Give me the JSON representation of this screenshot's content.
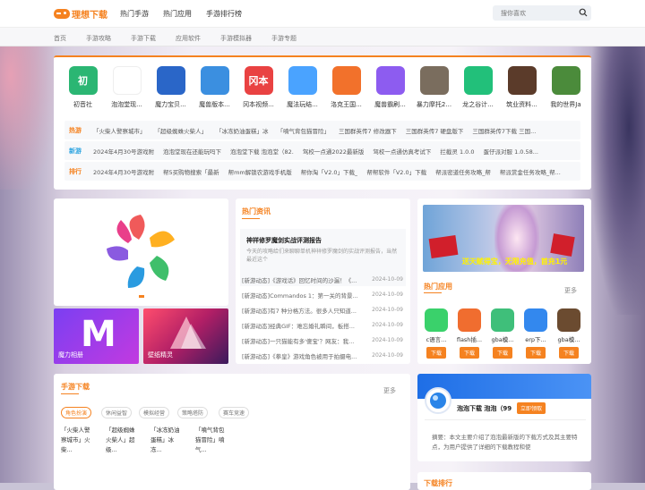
{
  "logo": {
    "text": "理想下载"
  },
  "nav": [
    "热门手游",
    "热门应用",
    "手游排行榜"
  ],
  "search": {
    "placeholder": "搜你喜欢"
  },
  "subnav": [
    "首页",
    "手游攻略",
    "手游下载",
    "应用软件",
    "手游模拟器",
    "手游专题"
  ],
  "apps": [
    {
      "label": "初音社",
      "icon": "chuyin-icon",
      "color": "#2bb673",
      "glyph": "初"
    },
    {
      "label": "泡泡堂现...",
      "icon": "star-swirl-icon",
      "color": "#ffffff",
      "glyph": ""
    },
    {
      "label": "魔力宝贝...",
      "icon": "tv-icon",
      "color": "#2a66c8",
      "glyph": ""
    },
    {
      "label": "魔兽版本...",
      "icon": "e-swirl-icon",
      "color": "#3b8fe0",
      "glyph": ""
    },
    {
      "label": "冈本视频...",
      "icon": "okamoto-icon",
      "color": "#e94242",
      "glyph": "冈本"
    },
    {
      "label": "魔法玩结...",
      "icon": "bird-icon",
      "color": "#4aa3ff",
      "glyph": ""
    },
    {
      "label": "洛克王国...",
      "icon": "roco-icon",
      "color": "#f2712b",
      "glyph": ""
    },
    {
      "label": "魔兽霸刷...",
      "icon": "fan-icon",
      "color": "#8d5cf0",
      "glyph": ""
    },
    {
      "label": "暴力摩托2...",
      "icon": "moto-icon",
      "color": "#7a6d5e",
      "glyph": ""
    },
    {
      "label": "龙之谷计...",
      "icon": "phone-icon",
      "color": "#22c07a",
      "glyph": ""
    },
    {
      "label": "筑业资料...",
      "icon": "medal-icon",
      "color": "#5b3b2a",
      "glyph": ""
    },
    {
      "label": "我的世界Ja",
      "icon": "minecraft-icon",
      "color": "#4b8b3b",
      "glyph": ""
    }
  ],
  "rows": [
    {
      "title": "热游",
      "color": "#f58220",
      "items": [
        "「火柴人警察城市」",
        "「超级蜘蛛火柴人」",
        "「冰冻奶油蛋糕」冰",
        "「噴气背包猫冒险」",
        "三国群英传7 修改器下",
        "三国群英传7 硬盘版下",
        "三国群英传7下载 三国..."
      ]
    },
    {
      "title": "新游",
      "color": "#2aa3e0",
      "items": [
        "2024年4月30号游戏附",
        "泡泡堂现在还能玩吗下",
        "泡泡堂下载 泡泡堂（82.",
        "驾校一点通2022最新版",
        "驾校一点通仿真考试下",
        "拦截灵 1.0.0",
        "蛋仔派对服 1.0.58..."
      ]
    },
    {
      "title": "排行",
      "color": "#f58220",
      "items": [
        "2024年4月30号游戏附",
        "帮5买购物搜索「最新",
        "帮mm解锁农游戏手机版",
        "帮你淘「V2.0」下载_",
        "帮帮软件「V2.0」下载",
        "帮派密道任务攻略_帮",
        "帮派赏金任务攻略_帮..."
      ]
    }
  ],
  "thumbs": [
    {
      "label": "魔力相册"
    },
    {
      "label": "壁纸精灵"
    }
  ],
  "hot_news": {
    "header": "热门资讯",
    "feature_title": "神祥修罗魔剑实战评测报告",
    "feature_desc": "今天的攻略给们来聊聊单机神祥修罗魔剑的实战评测报告，当然最近这个",
    "items": [
      {
        "text": "[新游动态]《游戏话》回忆时间的沙漏！《...",
        "date": "2024-10-09"
      },
      {
        "text": "[新游动态]Commandos 1：第一关的背景...",
        "date": "2024-10-09"
      },
      {
        "text": "[新游动态]有7 种分格方法。很多人只知道...",
        "date": "2024-10-09"
      },
      {
        "text": "[新游动态]经典GIF：难忘婚礼瞬间，板搭...",
        "date": "2024-10-09"
      },
      {
        "text": "[新游动态]一只猫能有多'傻宝'？网友：我...",
        "date": "2024-10-09"
      },
      {
        "text": "[新游动态]《拳皇》游戏角色被用于拍摄电...",
        "date": "2024-10-09"
      }
    ]
  },
  "banner": {
    "text": "送天赋得宝，无限充值，首充1元"
  },
  "hot_apps": {
    "header": "热门应用",
    "more": "更多",
    "items": [
      {
        "label": "c语言...",
        "icon": "chat-icon",
        "color": "#3ad16b"
      },
      {
        "label": "flash插...",
        "icon": "fox-icon",
        "color": "#f06d2f"
      },
      {
        "label": "gba模...",
        "icon": "e-icon",
        "color": "#3fbf7a"
      },
      {
        "label": "erp下...",
        "icon": "dots-icon",
        "color": "#3388ee"
      },
      {
        "label": "gba模...",
        "icon": "badge-icon",
        "color": "#6b4b30"
      }
    ],
    "button": "下载"
  },
  "mobile_dl": {
    "header": "手游下载",
    "more": "更多",
    "tabs": [
      "角色扮演",
      "休闲益智",
      "模拟经营",
      "策略塔防",
      "赛车竞速"
    ],
    "items": [
      "「火柴人警察城市」火柴...",
      "「超级蜘蛛火柴人」超级...",
      "「冰冻奶油蛋糕」冰冻...",
      "「噴气背包猫冒险」噴气..."
    ]
  },
  "paopao": {
    "title": "泡泡下载 泡泡（99",
    "button": "立即领取",
    "summary": "摘要：本文主要介绍了泡泡最新版的下载方式及其主要特点，为用户提供了详细的下载教程和使"
  },
  "bottom_header": "下载排行"
}
